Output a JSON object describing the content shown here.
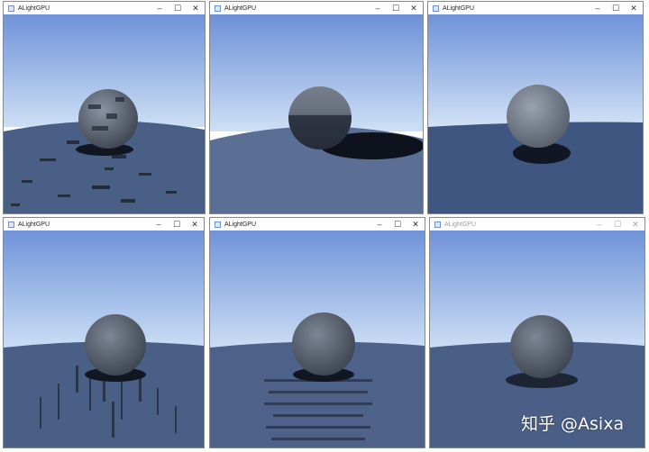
{
  "windows": [
    {
      "title": "ALightGPU",
      "minimize": "–",
      "maximize": "☐",
      "close": "✕",
      "active": true,
      "variant": "blocky"
    },
    {
      "title": "ALightGPU",
      "minimize": "–",
      "maximize": "☐",
      "close": "✕",
      "active": true,
      "variant": "hard-shadow"
    },
    {
      "title": "ALightGPU",
      "minimize": "–",
      "maximize": "☐",
      "close": "✕",
      "active": true,
      "variant": "clean"
    },
    {
      "title": "ALightGPU",
      "minimize": "–",
      "maximize": "☐",
      "close": "✕",
      "active": true,
      "variant": "streaks"
    },
    {
      "title": "ALightGPU",
      "minimize": "–",
      "maximize": "☐",
      "close": "✕",
      "active": true,
      "variant": "banded"
    },
    {
      "title": "ALightGPU",
      "minimize": "–",
      "maximize": "☐",
      "close": "✕",
      "active": false,
      "variant": "soft"
    }
  ],
  "watermark": "知乎 @Asixa",
  "colors": {
    "sky_top": "#6f93d8",
    "sky_horizon": "#cfe0f6",
    "ground": "#4a5f86",
    "sphere": "#6d7684",
    "shadow": "#111722"
  }
}
